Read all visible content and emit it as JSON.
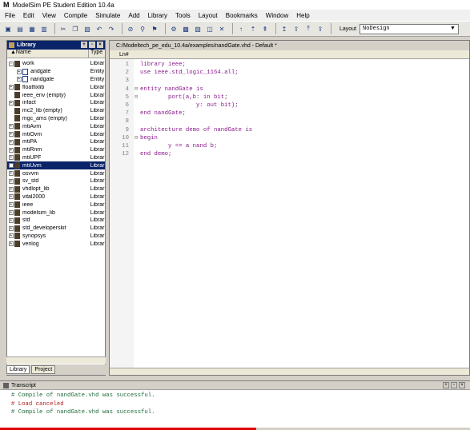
{
  "app": {
    "title": "ModelSim PE Student Edition 10.4a",
    "logo": "M"
  },
  "menu": [
    "File",
    "Edit",
    "View",
    "Compile",
    "Simulate",
    "Add",
    "Library",
    "Tools",
    "Layout",
    "Bookmarks",
    "Window",
    "Help"
  ],
  "toolbar": {
    "layout_label": "Layout",
    "layout_value": "NoDesign"
  },
  "library": {
    "title": "Library",
    "col_name": "▲Name",
    "col_type": "Type",
    "rows": [
      {
        "name": "work",
        "type": "Librar",
        "expand": "-",
        "indent": 0
      },
      {
        "name": "andgate",
        "type": "Entity",
        "expand": "+",
        "indent": 1,
        "entity": true
      },
      {
        "name": "nandgate",
        "type": "Entity",
        "expand": "+",
        "indent": 1,
        "entity": true
      },
      {
        "name": "floatfixlib",
        "type": "Librar",
        "expand": "+",
        "indent": 0
      },
      {
        "name": "ieee_env (empty)",
        "type": "Librar",
        "expand": "",
        "indent": 0
      },
      {
        "name": "infact",
        "type": "Librar",
        "expand": "+",
        "indent": 0
      },
      {
        "name": "mc2_lib (empty)",
        "type": "Librar",
        "expand": "",
        "indent": 0
      },
      {
        "name": "mgc_ams (empty)",
        "type": "Librar",
        "expand": "",
        "indent": 0
      },
      {
        "name": "mtiAvm",
        "type": "Librar",
        "expand": "+",
        "indent": 0
      },
      {
        "name": "mtiOvm",
        "type": "Librar",
        "expand": "+",
        "indent": 0
      },
      {
        "name": "mtiPA",
        "type": "Librar",
        "expand": "+",
        "indent": 0
      },
      {
        "name": "mtiRnm",
        "type": "Librar",
        "expand": "+",
        "indent": 0
      },
      {
        "name": "mtiUPF",
        "type": "Librar",
        "expand": "+",
        "indent": 0
      },
      {
        "name": "mtiUvm",
        "type": "Librar",
        "expand": "+",
        "indent": 0,
        "selected": true
      },
      {
        "name": "osvvm",
        "type": "Librar",
        "expand": "+",
        "indent": 0
      },
      {
        "name": "sv_std",
        "type": "Librar",
        "expand": "+",
        "indent": 0
      },
      {
        "name": "vhdlopt_lib",
        "type": "Librar",
        "expand": "+",
        "indent": 0
      },
      {
        "name": "vital2000",
        "type": "Librar",
        "expand": "+",
        "indent": 0
      },
      {
        "name": "ieee",
        "type": "Librar",
        "expand": "+",
        "indent": 0
      },
      {
        "name": "modelsim_lib",
        "type": "Librar",
        "expand": "+",
        "indent": 0
      },
      {
        "name": "std",
        "type": "Librar",
        "expand": "+",
        "indent": 0
      },
      {
        "name": "std_developerskit",
        "type": "Librar",
        "expand": "+",
        "indent": 0
      },
      {
        "name": "synopsys",
        "type": "Librar",
        "expand": "+",
        "indent": 0
      },
      {
        "name": "verilog",
        "type": "Librar",
        "expand": "+",
        "indent": 0
      }
    ],
    "tabs": [
      "Library",
      "Project"
    ]
  },
  "editor": {
    "path": "C:/Modeltech_pe_edu_10.4a/examples/nandGate.vhd - Default *",
    "col_label": "Ln#",
    "lines": [
      {
        "n": "1",
        "fold": "",
        "text": "library ieee;"
      },
      {
        "n": "2",
        "fold": "",
        "text": "use ieee.std_logic_1164.all;"
      },
      {
        "n": "3",
        "fold": "",
        "text": ""
      },
      {
        "n": "4",
        "fold": "⊟",
        "text": "entity nandGate is"
      },
      {
        "n": "5",
        "fold": "⊟",
        "text": "        port(a,b: in bit;"
      },
      {
        "n": "6",
        "fold": "",
        "text": "                y: out bit);"
      },
      {
        "n": "7",
        "fold": "",
        "text": "end nandGate;"
      },
      {
        "n": "8",
        "fold": "",
        "text": ""
      },
      {
        "n": "9",
        "fold": "",
        "text": "architecture demo of nandGate is"
      },
      {
        "n": "10",
        "fold": "⊟",
        "text": "begin"
      },
      {
        "n": "11",
        "fold": "",
        "text": "        y <= a nand b;"
      },
      {
        "n": "12",
        "fold": "",
        "text": "end demo;"
      }
    ]
  },
  "transcript": {
    "title": "Transcript",
    "lines": [
      {
        "kind": "ok",
        "text": "# Compile of nandGate.vhd was successful."
      },
      {
        "kind": "warn",
        "text": "# Load canceled"
      },
      {
        "kind": "ok",
        "text": "# Compile of nandGate.vhd was successful."
      }
    ]
  }
}
